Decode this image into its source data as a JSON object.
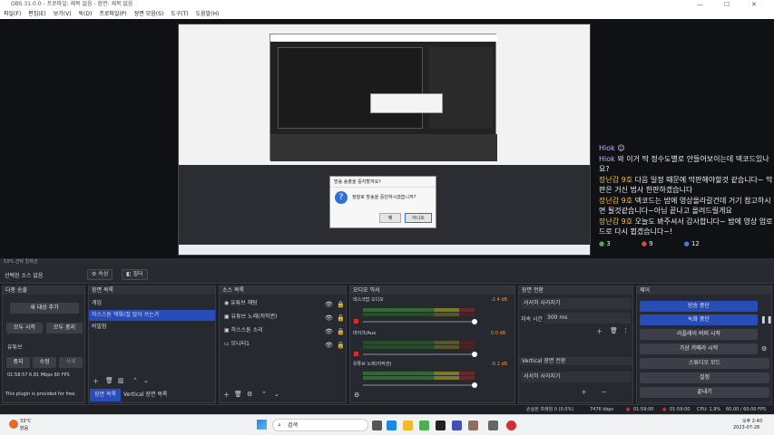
{
  "window": {
    "title": "OBS 31.0.0 - 프로파일: 제목 없음 - 장면: 제목 없음",
    "minimize": "—",
    "maximize": "☐",
    "close": "✕"
  },
  "menu": [
    "파일(F)",
    "편집(E)",
    "보기(V)",
    "독(D)",
    "프로파일(P)",
    "장면 모음(S)",
    "도구(T)",
    "도움말(H)"
  ],
  "dialog": {
    "title": "방송 송출을 중지할까요?",
    "message": "정말로 방송을 중단하시겠습니까?",
    "yes": "예",
    "no": "아니오"
  },
  "chat": {
    "messages": [
      {
        "user": "Hiok",
        "text": "",
        "icon": "purple-face-icon"
      },
      {
        "user": "Hiok",
        "text": "와 이거 딱 정수도별로 안들어보이는데 덱코드있나요?"
      },
      {
        "user": "장난감 9호",
        "text": "다음 일정 때문에 막판해야할것 같습니다~ 막판은 거신 법사 한판하겠습니다"
      },
      {
        "user": "장난감 9호",
        "text": "덱코드는 밤에 영상올라갈건데 거기 참고하시면 될것같습니다~아님 끝나고 올려드릴게요"
      },
      {
        "user": "장난감 9호",
        "text": "오늘도 봐주셔서 감사합니다~ 밤에 영상 업로드로 다시 뵙겠습니다~!"
      }
    ],
    "counts": [
      "3",
      "9",
      "12"
    ]
  },
  "scene_bar": {
    "label": "53%   선택 컬렉션"
  },
  "source_bar": {
    "label": "선택된 소스 없음",
    "props": "⚙ 속성",
    "filters": "◧ 필터"
  },
  "docks": {
    "quick": {
      "title": "다중 송출",
      "add": "새 대상 추가",
      "start_all": "모두 시작",
      "stop_all": "모두 중지",
      "youtube": "유튜브",
      "stop": "중지",
      "edit": "수정",
      "delete": "삭제",
      "stats": "01:58:57  6.81 Mbps  60 FPS",
      "note": "This plugin is provided for free."
    },
    "scenes": {
      "title": "장면 목록",
      "items": [
        "게임",
        "하스스톤 덱화(절 많이 쓰는가",
        "비밀함"
      ],
      "tab1": "장면 목록",
      "tab2": "Vertical 장면 목록"
    },
    "sources": {
      "title": "소스 목록",
      "items": [
        "유튜브 채팅",
        "유튜브 노래(저작권)",
        "하스스톤 소리",
        "모니터1"
      ]
    },
    "mixer": {
      "title": "오디오 믹서",
      "channels": [
        {
          "name": "데스크탑 오디오",
          "db": "-2.4 dB"
        },
        {
          "name": "마이크/Aux",
          "db": "0.0 dB"
        },
        {
          "name": "유튜브 노래(저작권)",
          "db": "-0.1 dB"
        }
      ],
      "ticks": [
        "-60",
        "-55",
        "-50",
        "-45",
        "-40",
        "-35",
        "-30",
        "-25",
        "-20",
        "-15",
        "-10",
        "-5",
        "0"
      ]
    },
    "transitions": {
      "title": "장면 전환",
      "type": "서서히 사라지기",
      "duration_label": "지속 시간",
      "duration": "300 ms",
      "vertical_title": "Vertical 장면 전환",
      "vertical_type": "서서히 사라지기"
    },
    "controls": {
      "title": "제어",
      "stop_stream": "방송 중단",
      "stop_record": "녹화 중단",
      "replay": "리플레이 버퍼 시작",
      "vcam": "가상 카메라 시작",
      "studio": "스튜디오 모드",
      "settings": "설정",
      "exit": "끝내기"
    }
  },
  "status": {
    "dropped": "손실된 프레임 0 (0.0%)",
    "bitrate": "7476 kbps",
    "stream_time": "01:59:00",
    "rec_time": "01:59:00",
    "cpu": "CPU: 1.9%",
    "fps": "60.00 / 60.00 FPS"
  },
  "taskbar": {
    "weather_temp": "33°C",
    "weather": "맑음",
    "search": "검색",
    "time": "오후 2:40",
    "date": "2023-07-28"
  },
  "colors": {
    "accent_blue": "#284cb8",
    "live_red": "#d23030",
    "chat_name": "#f3c142"
  }
}
